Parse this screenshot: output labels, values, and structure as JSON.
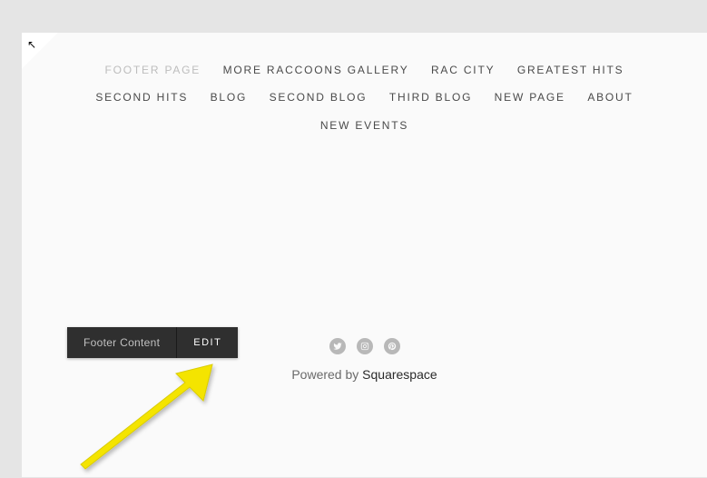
{
  "nav": {
    "items": [
      {
        "label": "FOOTER PAGE",
        "active": true
      },
      {
        "label": "MORE RACCOONS GALLERY",
        "active": false
      },
      {
        "label": "RAC CITY",
        "active": false
      },
      {
        "label": "GREATEST HITS",
        "active": false
      },
      {
        "label": "SECOND HITS",
        "active": false
      },
      {
        "label": "BLOG",
        "active": false
      },
      {
        "label": "SECOND BLOG",
        "active": false
      },
      {
        "label": "THIRD BLOG",
        "active": false
      },
      {
        "label": "NEW PAGE",
        "active": false
      },
      {
        "label": "ABOUT",
        "active": false
      },
      {
        "label": "NEW EVENTS",
        "active": false
      }
    ]
  },
  "editWidget": {
    "label": "Footer Content",
    "button": "EDIT"
  },
  "social": {
    "icons": [
      "twitter-icon",
      "instagram-icon",
      "pinterest-icon"
    ]
  },
  "footer": {
    "poweredPrefix": "Powered by ",
    "poweredBrand": "Squarespace"
  }
}
